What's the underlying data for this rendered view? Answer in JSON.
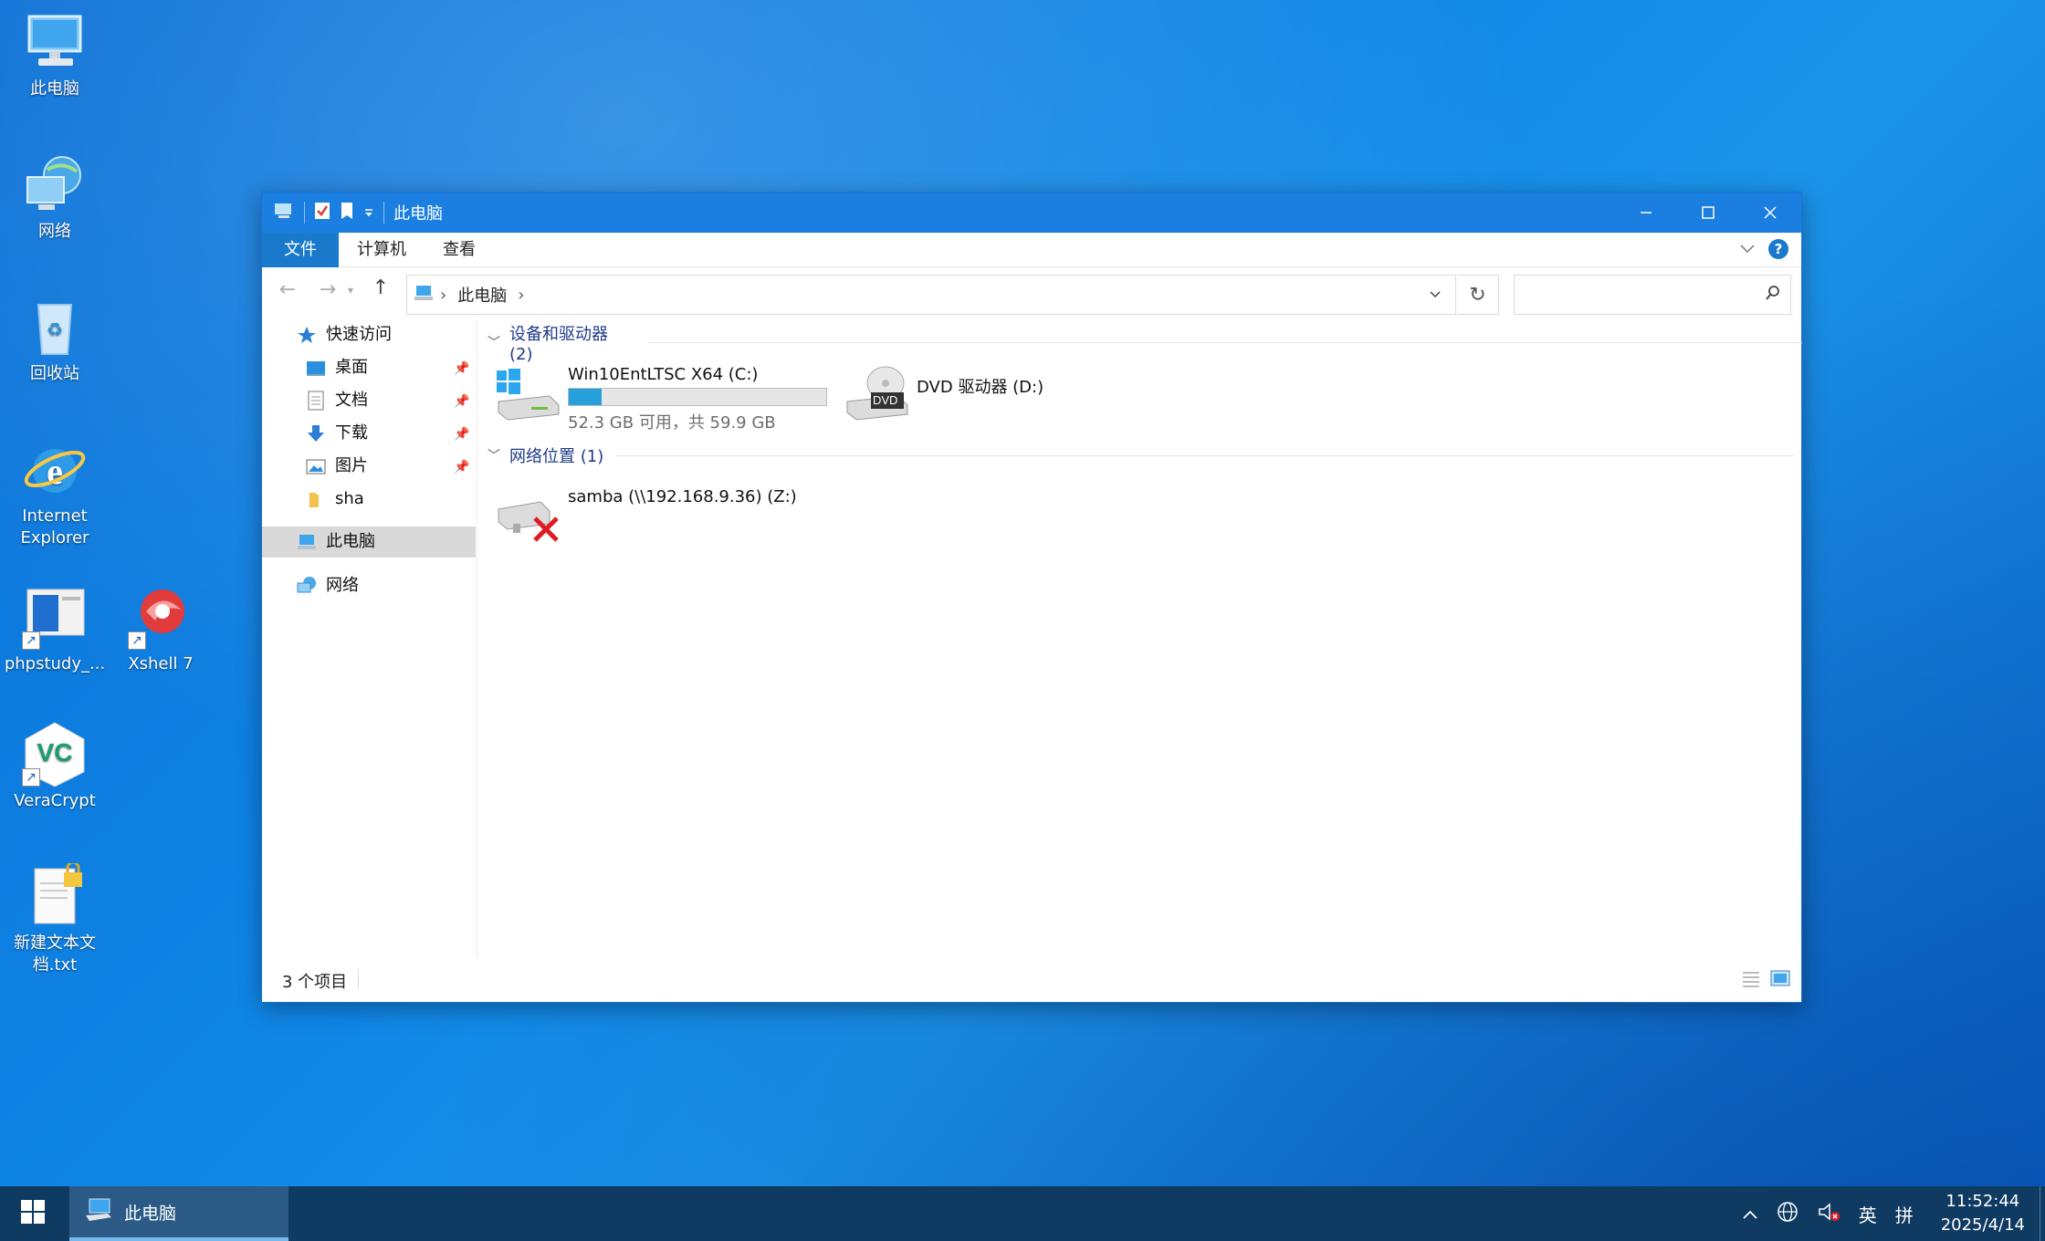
{
  "desktop": {
    "icons": [
      {
        "label": "此电脑"
      },
      {
        "label": "网络"
      },
      {
        "label": "回收站"
      },
      {
        "label": "Internet Explorer"
      },
      {
        "label": "phpstudy_..."
      },
      {
        "label": "Xshell 7"
      },
      {
        "label": "VeraCrypt"
      },
      {
        "label": "新建文本文档.txt"
      }
    ]
  },
  "window": {
    "title": "此电脑",
    "ribbon": {
      "file": "文件",
      "computer": "计算机",
      "view": "查看",
      "help": "?"
    },
    "address": {
      "segment": "此电脑",
      "sep": "›"
    },
    "search": {
      "placeholder": ""
    },
    "nav": {
      "quick_access": "快速访问",
      "desktop": "桌面",
      "documents": "文档",
      "downloads": "下载",
      "pictures": "图片",
      "sha": "sha",
      "this_pc": "此电脑",
      "network": "网络"
    },
    "groups": {
      "devices": "设备和驱动器 (2)",
      "network": "网络位置 (1)"
    },
    "drives": {
      "c": {
        "name": "Win10EntLTSC X64 (C:)",
        "usage": "52.3 GB 可用，共 59.9 GB",
        "used_fraction": 0.127
      },
      "d": {
        "name": "DVD 驱动器 (D:)",
        "badge": "DVD"
      },
      "z": {
        "name": "samba (\\\\192.168.9.36) (Z:)"
      }
    },
    "status": {
      "count": "3 个项目"
    }
  },
  "taskbar": {
    "task_label": "此电脑",
    "ime_lang": "英",
    "ime_mode": "拼",
    "time": "11:52:44",
    "date": "2025/4/14"
  },
  "colors": {
    "accent": "#1a7fe0",
    "taskbar": "#0f3b62",
    "progress": "#26a0da"
  }
}
